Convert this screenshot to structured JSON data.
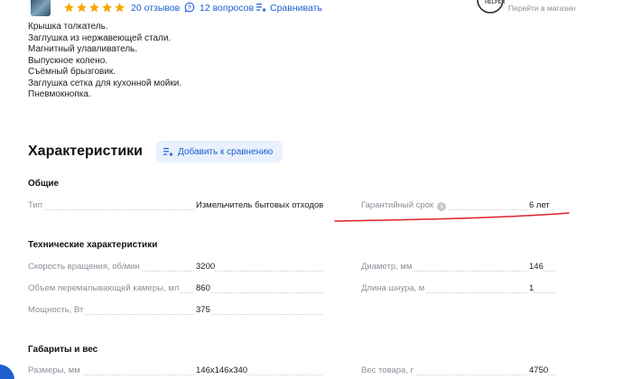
{
  "header": {
    "rating_stars": 5,
    "reviews": "20 отзывов",
    "questions": "12 вопросов",
    "compare": "Сравнивать",
    "brand_text": "HELPER",
    "shop_link": "Перейти в магазин"
  },
  "package": {
    "items": [
      "Крышка толкатель.",
      "Заглушка из нержавеющей стали.",
      "Магнитный улавливатель.",
      "Выпускное колено.",
      "Съёмный брызговик.",
      "Заглушка сетка для кухонной мойки.",
      "Пневмокнопка."
    ]
  },
  "specs": {
    "title": "Характеристики",
    "add_compare": "Добавить к сравнению",
    "general": {
      "title": "Общие",
      "type_label": "Тип",
      "type_value": "Измельчитель бытовых отходов",
      "warranty_label": "Гарантийный срок",
      "warranty_value": "6 лет"
    },
    "technical": {
      "title": "Технические характеристики",
      "speed_label": "Скорость вращения, об/мин",
      "speed_value": "3200",
      "diameter_label": "Диаметр, мм",
      "diameter_value": "146",
      "volume_label": "Объем перемалывающей камеры, мл",
      "volume_value": "860",
      "cord_label": "Длина шнура, м",
      "cord_value": "1",
      "power_label": "Мощность, Вт",
      "power_value": "375"
    },
    "dimensions": {
      "title": "Габариты и вес",
      "size_label": "Размеры, мм",
      "size_value": "146x146x340",
      "weight_label": "Вес товара, г",
      "weight_value": "4750"
    }
  },
  "colors": {
    "accent": "#1e5fd0",
    "star": "#f7a600",
    "annotation": "#e0202a"
  }
}
